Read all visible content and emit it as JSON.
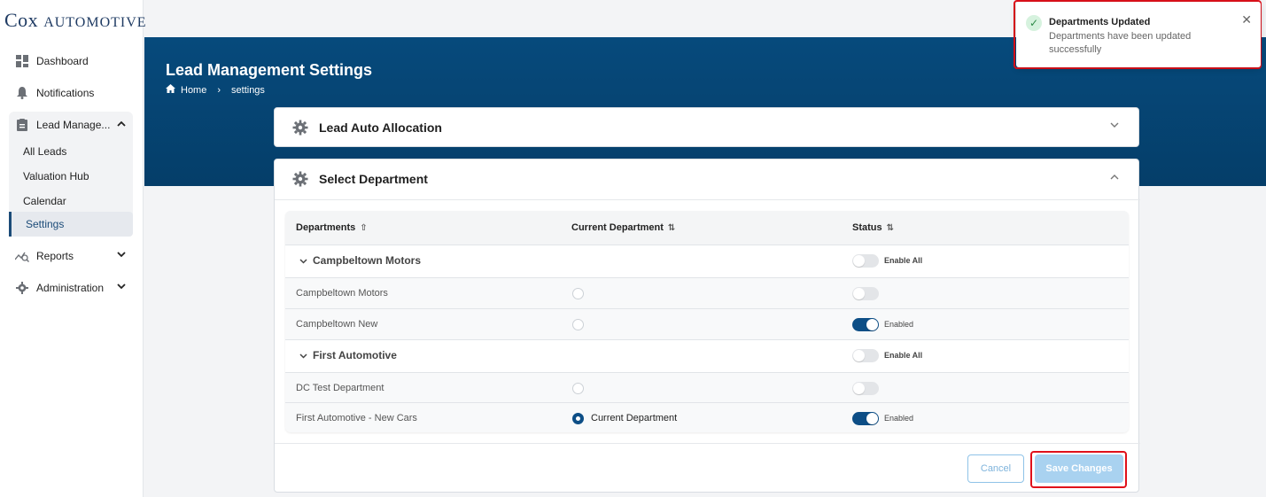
{
  "brand": {
    "logo_main": "Cox",
    "logo_rest": "Automotive"
  },
  "sidebar": {
    "items": [
      {
        "label": "Dashboard",
        "icon": "dashboard-icon"
      },
      {
        "label": "Notifications",
        "icon": "bell-icon"
      },
      {
        "label": "Lead Manage...",
        "icon": "clipboard-icon"
      },
      {
        "label": "Reports",
        "icon": "chart-icon"
      },
      {
        "label": "Administration",
        "icon": "gear-icon"
      }
    ],
    "lead_sub": [
      "All Leads",
      "Valuation Hub",
      "Calendar",
      "Settings"
    ]
  },
  "header": {
    "title": "Lead Management Settings",
    "breadcrumb": [
      "Home",
      "settings"
    ]
  },
  "cards": {
    "auto_allocation": "Lead Auto Allocation",
    "select_department": "Select Department"
  },
  "table": {
    "columns": [
      "Departments",
      "Current Department",
      "Status"
    ],
    "groups": [
      {
        "name": "Campbeltown Motors",
        "enable_all_label": "Enable All",
        "rows": [
          {
            "name": "Campbeltown Motors",
            "current": false,
            "current_label": "",
            "enabled": false,
            "status_label": ""
          },
          {
            "name": "Campbeltown New",
            "current": false,
            "current_label": "",
            "enabled": true,
            "status_label": "Enabled"
          }
        ]
      },
      {
        "name": "First Automotive",
        "enable_all_label": "Enable All",
        "rows": [
          {
            "name": "DC Test Department",
            "current": false,
            "current_label": "",
            "enabled": false,
            "status_label": ""
          },
          {
            "name": "First Automotive - New Cars",
            "current": true,
            "current_label": "Current Department",
            "enabled": true,
            "status_label": "Enabled"
          }
        ]
      }
    ]
  },
  "actions": {
    "cancel": "Cancel",
    "save": "Save Changes"
  },
  "toast": {
    "title": "Departments Updated",
    "message": "Departments have been updated successfully",
    "close": "✕"
  },
  "colors": {
    "brand_blue": "#064a7c",
    "accent": "#0d4e86",
    "highlight": "#e0101a"
  }
}
